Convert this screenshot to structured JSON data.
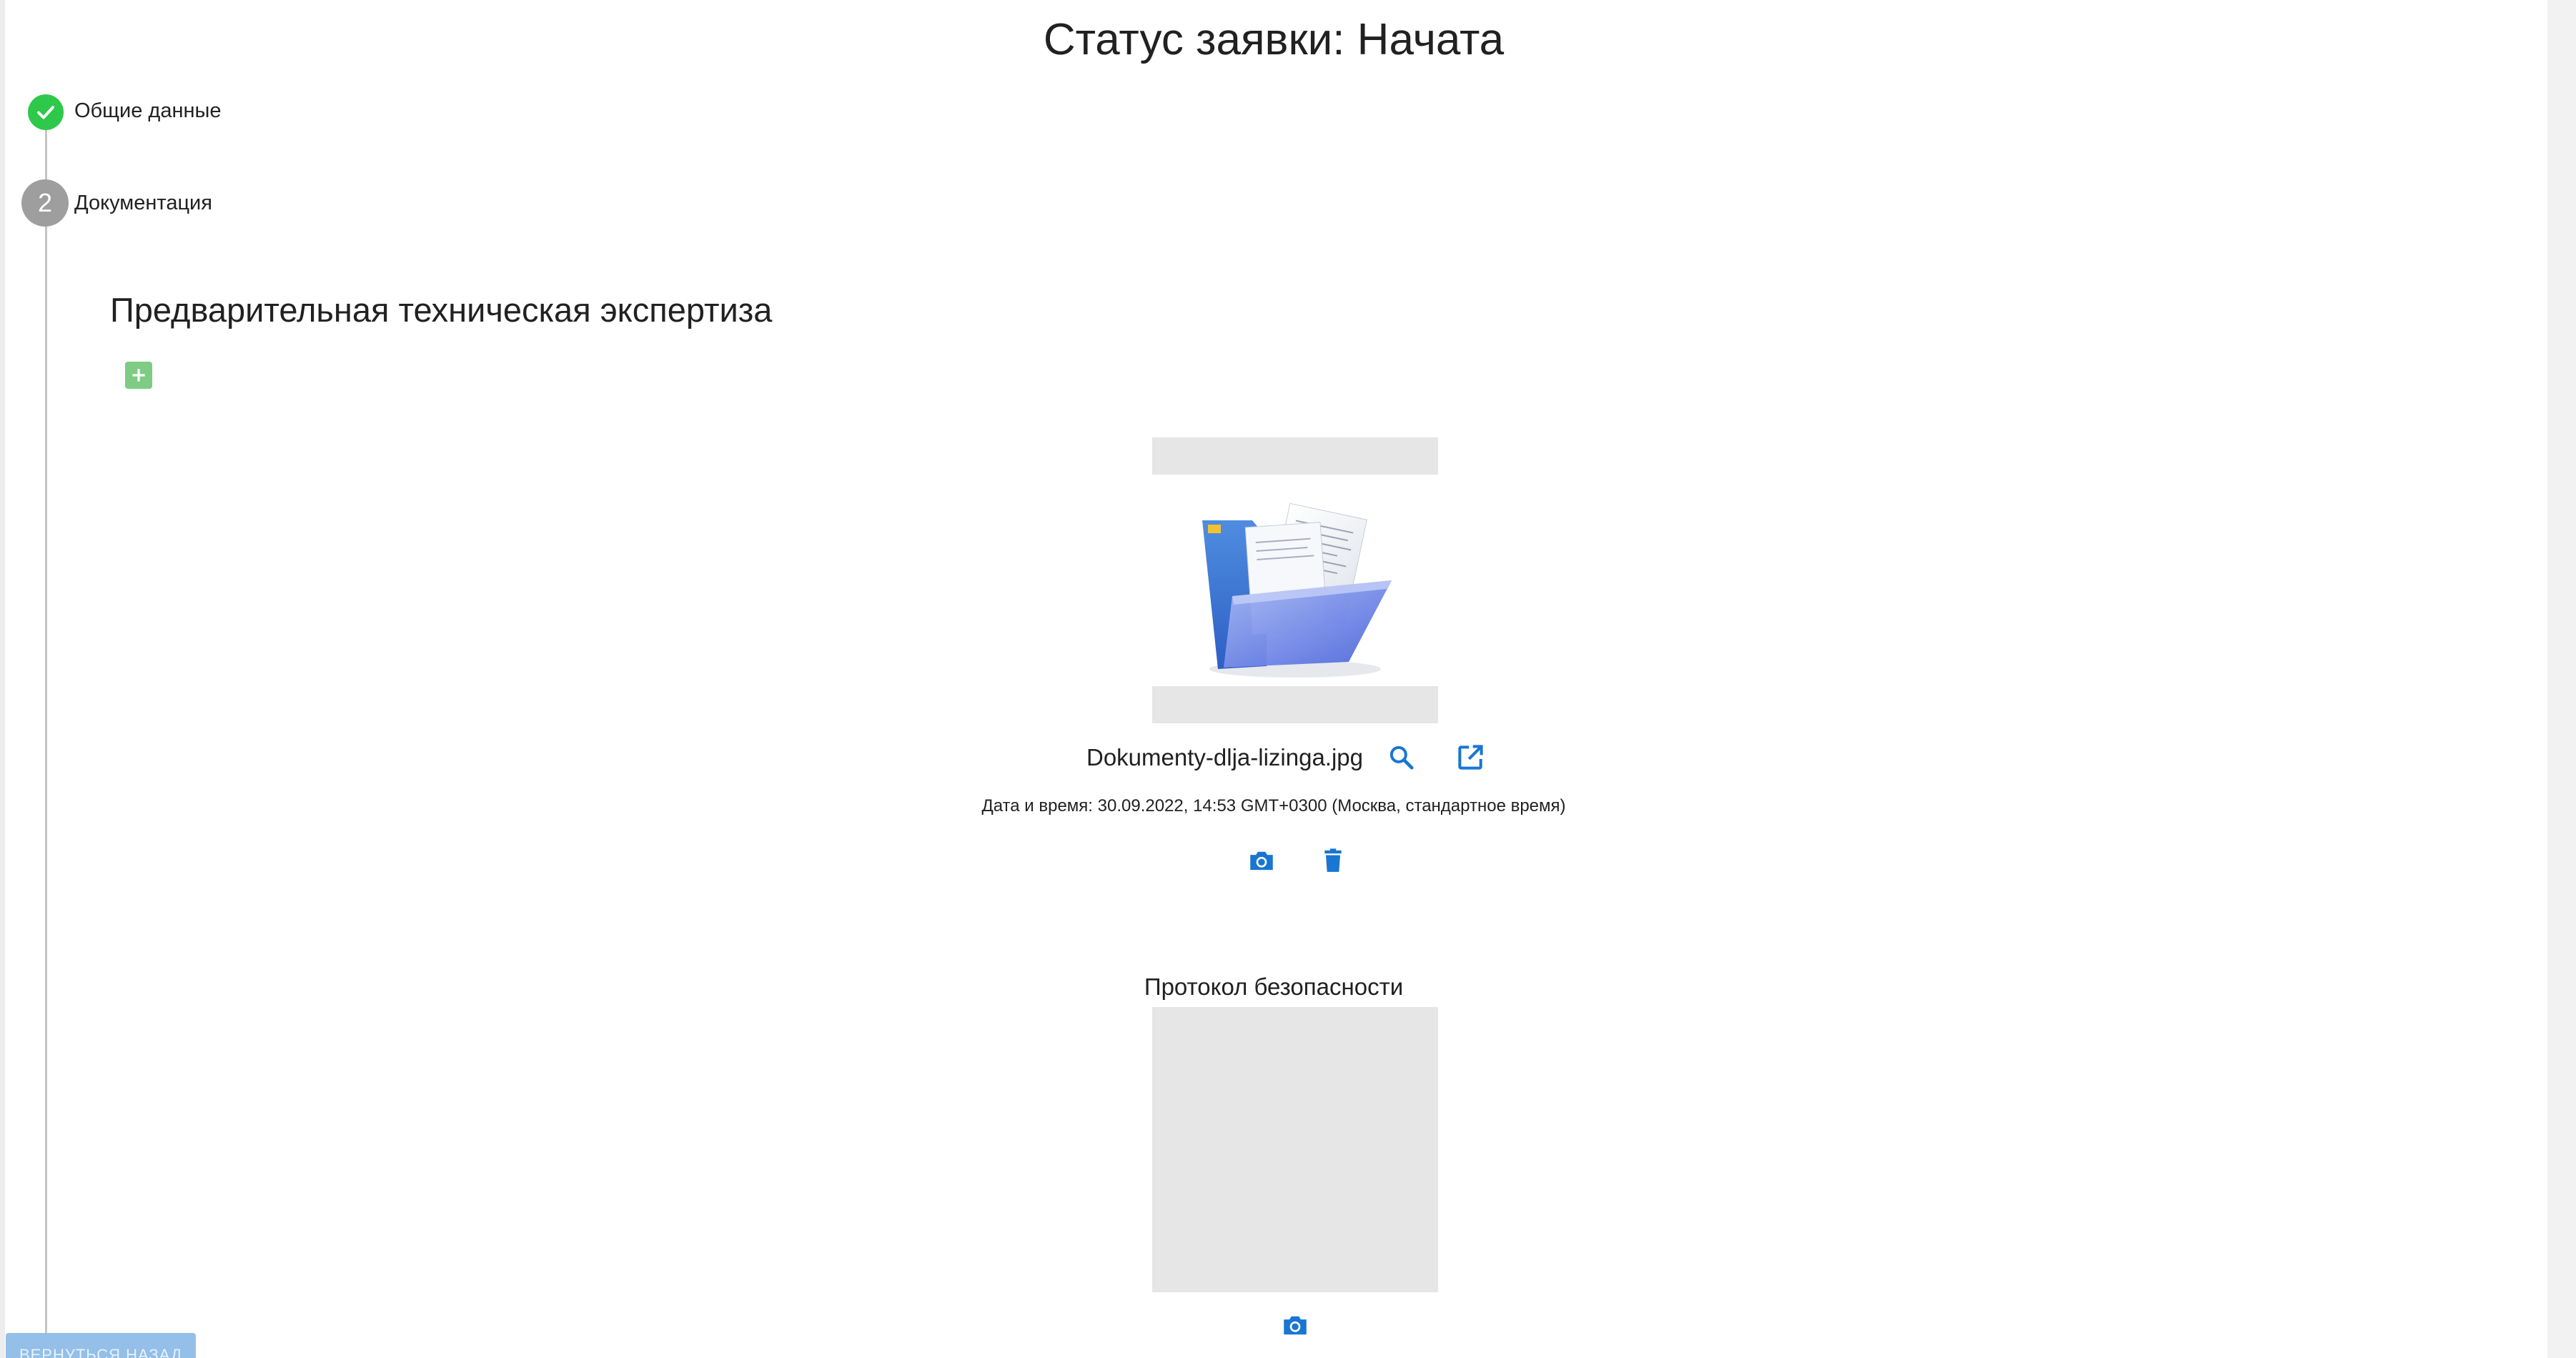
{
  "header": {
    "status_title": "Статус заявки: Начата"
  },
  "stepper": {
    "steps": [
      {
        "label": "Общие данные",
        "state": "completed"
      },
      {
        "label": "Документация",
        "number": "2",
        "state": "active"
      }
    ]
  },
  "section": {
    "title": "Предварительная техническая экспертиза",
    "add_icon": "plus-square-icon"
  },
  "document": {
    "file_name": "Dokumenty-dlja-lizinga.jpg",
    "date_line": "Дата и время: 30.09.2022, 14:53 GMT+0300 (Москва, стандартное время)",
    "thumbnail_icon": "folder-with-documents-image",
    "actions": {
      "preview_icon": "search-icon",
      "open_icon": "open-in-new-icon",
      "camera_icon": "camera-icon",
      "delete_icon": "trash-icon"
    }
  },
  "protocol": {
    "title": "Протокол безопасности",
    "camera_icon": "camera-icon"
  },
  "footer": {
    "back_button_label": "ВЕРНУТЬСЯ НАЗАД"
  },
  "colors": {
    "accent_blue": "#1976d2",
    "success_green": "#2ec84a",
    "add_green": "#7ecb83",
    "step_gray": "#9e9e9e",
    "placeholder_gray": "#e6e6e6",
    "back_button_bg": "#93bfe8"
  }
}
